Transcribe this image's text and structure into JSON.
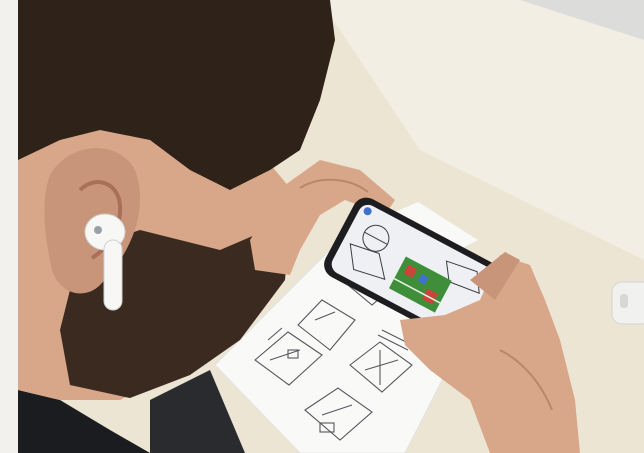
{
  "scene": {
    "subject": "person-wearing-wireless-earbud",
    "device": "smartphone-in-landscape",
    "colors": {
      "frame": "#f2f1ee",
      "table": "#ece5d4",
      "table_far": "#f3eee3",
      "wall": "#dcdcdb",
      "hair": "#2e2219",
      "beard": "#3a2a1f",
      "skin": "#d8a78a",
      "skin_shadow": "#b7866c",
      "earbud": "#f7f7f5",
      "shirt": "#1b1c1f",
      "paper": "#f9f9f8",
      "ink": "#55585c",
      "phone_body": "#1d1d1f",
      "phone_screen": "#eef0f3",
      "ar_green": "#3f8f3a",
      "ar_red": "#c9443a",
      "ar_blue": "#3f6fd1",
      "case": "#f1f1f0",
      "chair": "#2a2b2e"
    },
    "paper_diagrams": [
      "circuit-box-1",
      "circuit-box-2",
      "circuit-box-3",
      "circuit-box-4",
      "circuit-box-5"
    ]
  }
}
